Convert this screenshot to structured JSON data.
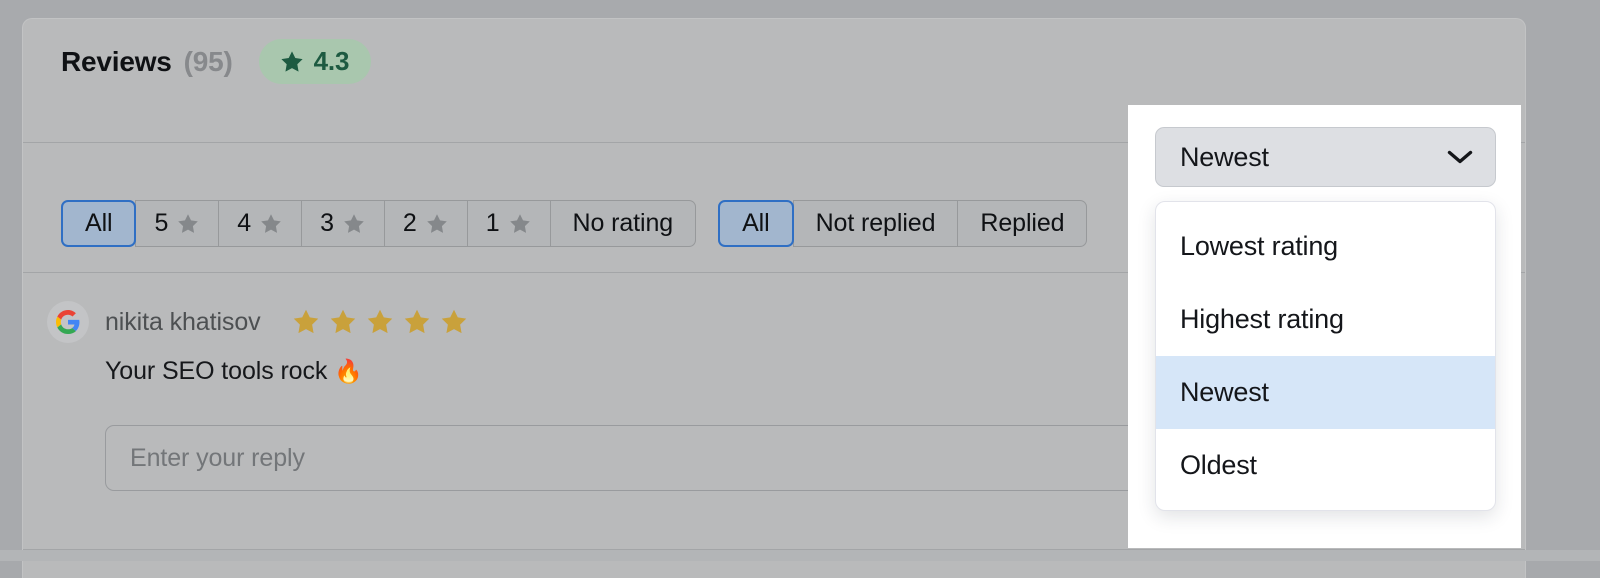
{
  "header": {
    "title": "Reviews",
    "count": "(95)",
    "rating_value": "4.3",
    "badge_bg": "#a9c7ae",
    "badge_fg": "#1d5a41"
  },
  "filters": {
    "rating_group": [
      {
        "label": "All",
        "star": false,
        "selected": true
      },
      {
        "label": "5",
        "star": true,
        "selected": false
      },
      {
        "label": "4",
        "star": true,
        "selected": false
      },
      {
        "label": "3",
        "star": true,
        "selected": false
      },
      {
        "label": "2",
        "star": true,
        "selected": false
      },
      {
        "label": "1",
        "star": true,
        "selected": false
      },
      {
        "label": "No rating",
        "star": false,
        "selected": false
      }
    ],
    "reply_group": [
      {
        "label": "All",
        "selected": true
      },
      {
        "label": "Not replied",
        "selected": false
      },
      {
        "label": "Replied",
        "selected": false
      }
    ],
    "selected_border_color": "#2f6fc4",
    "selected_fill_color": "#a2b6ce"
  },
  "sort": {
    "selected_label": "Newest",
    "chevron_icon": "chevron-down-icon",
    "options": [
      {
        "label": "Lowest rating",
        "active": false
      },
      {
        "label": "Highest rating",
        "active": false
      },
      {
        "label": "Newest",
        "active": true
      },
      {
        "label": "Oldest",
        "active": false
      }
    ],
    "active_option_bg": "#d6e6f8"
  },
  "reviews": [
    {
      "source_icon": "google-icon",
      "author": "nikita khatisov",
      "stars": 5,
      "star_color": "#c9a13b",
      "text": "Your SEO tools rock",
      "emoji": "🔥",
      "reply_placeholder": "Enter your reply",
      "reply_value": ""
    }
  ]
}
